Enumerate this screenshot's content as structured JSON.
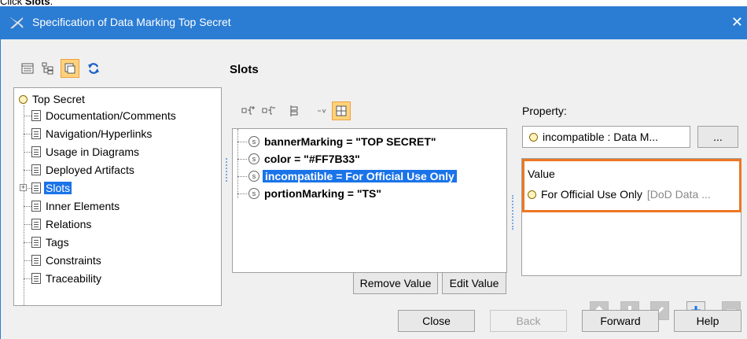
{
  "instruction": {
    "prefix": "Click ",
    "target": "Slots",
    "suffix": "."
  },
  "window": {
    "title": "Specification of Data Marking Top Secret",
    "close_glyph": "✕"
  },
  "left_toolbar": {
    "icons": [
      "list-view-icon",
      "tree-view-icon",
      "compartment-view-icon",
      "refresh-icon"
    ]
  },
  "panel_title": "Slots",
  "tree": {
    "root": "Top Secret",
    "items": [
      {
        "label": "Documentation/Comments"
      },
      {
        "label": "Navigation/Hyperlinks"
      },
      {
        "label": "Usage in Diagrams"
      },
      {
        "label": "Deployed Artifacts"
      },
      {
        "label": "Slots",
        "selected": true,
        "expandable": true
      },
      {
        "label": "Inner Elements"
      },
      {
        "label": "Relations"
      },
      {
        "label": "Tags"
      },
      {
        "label": "Constraints"
      },
      {
        "label": "Traceability"
      }
    ]
  },
  "slots_toolbar": {
    "icons": [
      "expand-all-icon",
      "collapse-all-icon",
      "group-icon",
      "show-values-icon",
      "layout-icon"
    ]
  },
  "slots": [
    {
      "label": "bannerMarking = \"TOP SECRET\""
    },
    {
      "label": "color = \"#FF7B33\""
    },
    {
      "label": "incompatible = For Official Use Only",
      "selected": true
    },
    {
      "label": "portionMarking = \"TS\""
    }
  ],
  "slot_buttons": {
    "remove": "Remove Value",
    "edit": "Edit Value"
  },
  "property": {
    "label": "Property:",
    "value": "incompatible : Data M...",
    "more": "..."
  },
  "value": {
    "header": "Value",
    "item": "For Official Use Only",
    "item_type": "[DoD Data ..."
  },
  "value_actions": [
    "arrow-up-icon",
    "arrow-down-icon",
    "pencil-icon",
    "plus-icon",
    "minus-icon"
  ],
  "footer": {
    "close": "Close",
    "back": "Back",
    "forward": "Forward",
    "help": "Help"
  },
  "colors": {
    "title_bar": "#2b7cd3",
    "selection": "#1a73e8",
    "highlight_border": "#ee7723",
    "active_toggle": "#ffd27a"
  }
}
